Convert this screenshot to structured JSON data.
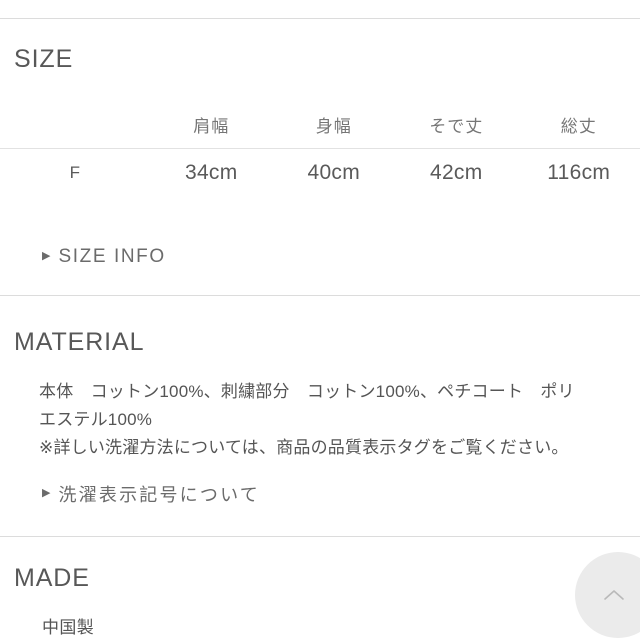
{
  "sections": {
    "size": {
      "heading": "SIZE",
      "table": {
        "columns": [
          "",
          "肩幅",
          "身幅",
          "そで丈",
          "総丈"
        ],
        "rows": [
          {
            "label": "F",
            "values": [
              "34cm",
              "40cm",
              "42cm",
              "116cm"
            ]
          }
        ]
      },
      "disclosure": {
        "marker": "▶",
        "label": "SIZE INFO"
      }
    },
    "material": {
      "heading": "MATERIAL",
      "body_lines": [
        "本体　コットン100%、刺繍部分　コットン100%、ペチコート　ポリ",
        "エステル100%",
        "※詳しい洗濯方法については、商品の品質表示タグをご覧ください。"
      ],
      "disclosure": {
        "marker": "▶",
        "label": "洗濯表示記号について"
      }
    },
    "made": {
      "heading": "MADE",
      "body": "中国製"
    }
  },
  "floating": {
    "scroll_top_icon": "chevron-up-icon"
  },
  "colors": {
    "text_primary": "#555555",
    "text_heading": "#585858",
    "text_muted": "#767676",
    "divider": "#dcdcdc",
    "button_bg": "#ebebeb"
  }
}
